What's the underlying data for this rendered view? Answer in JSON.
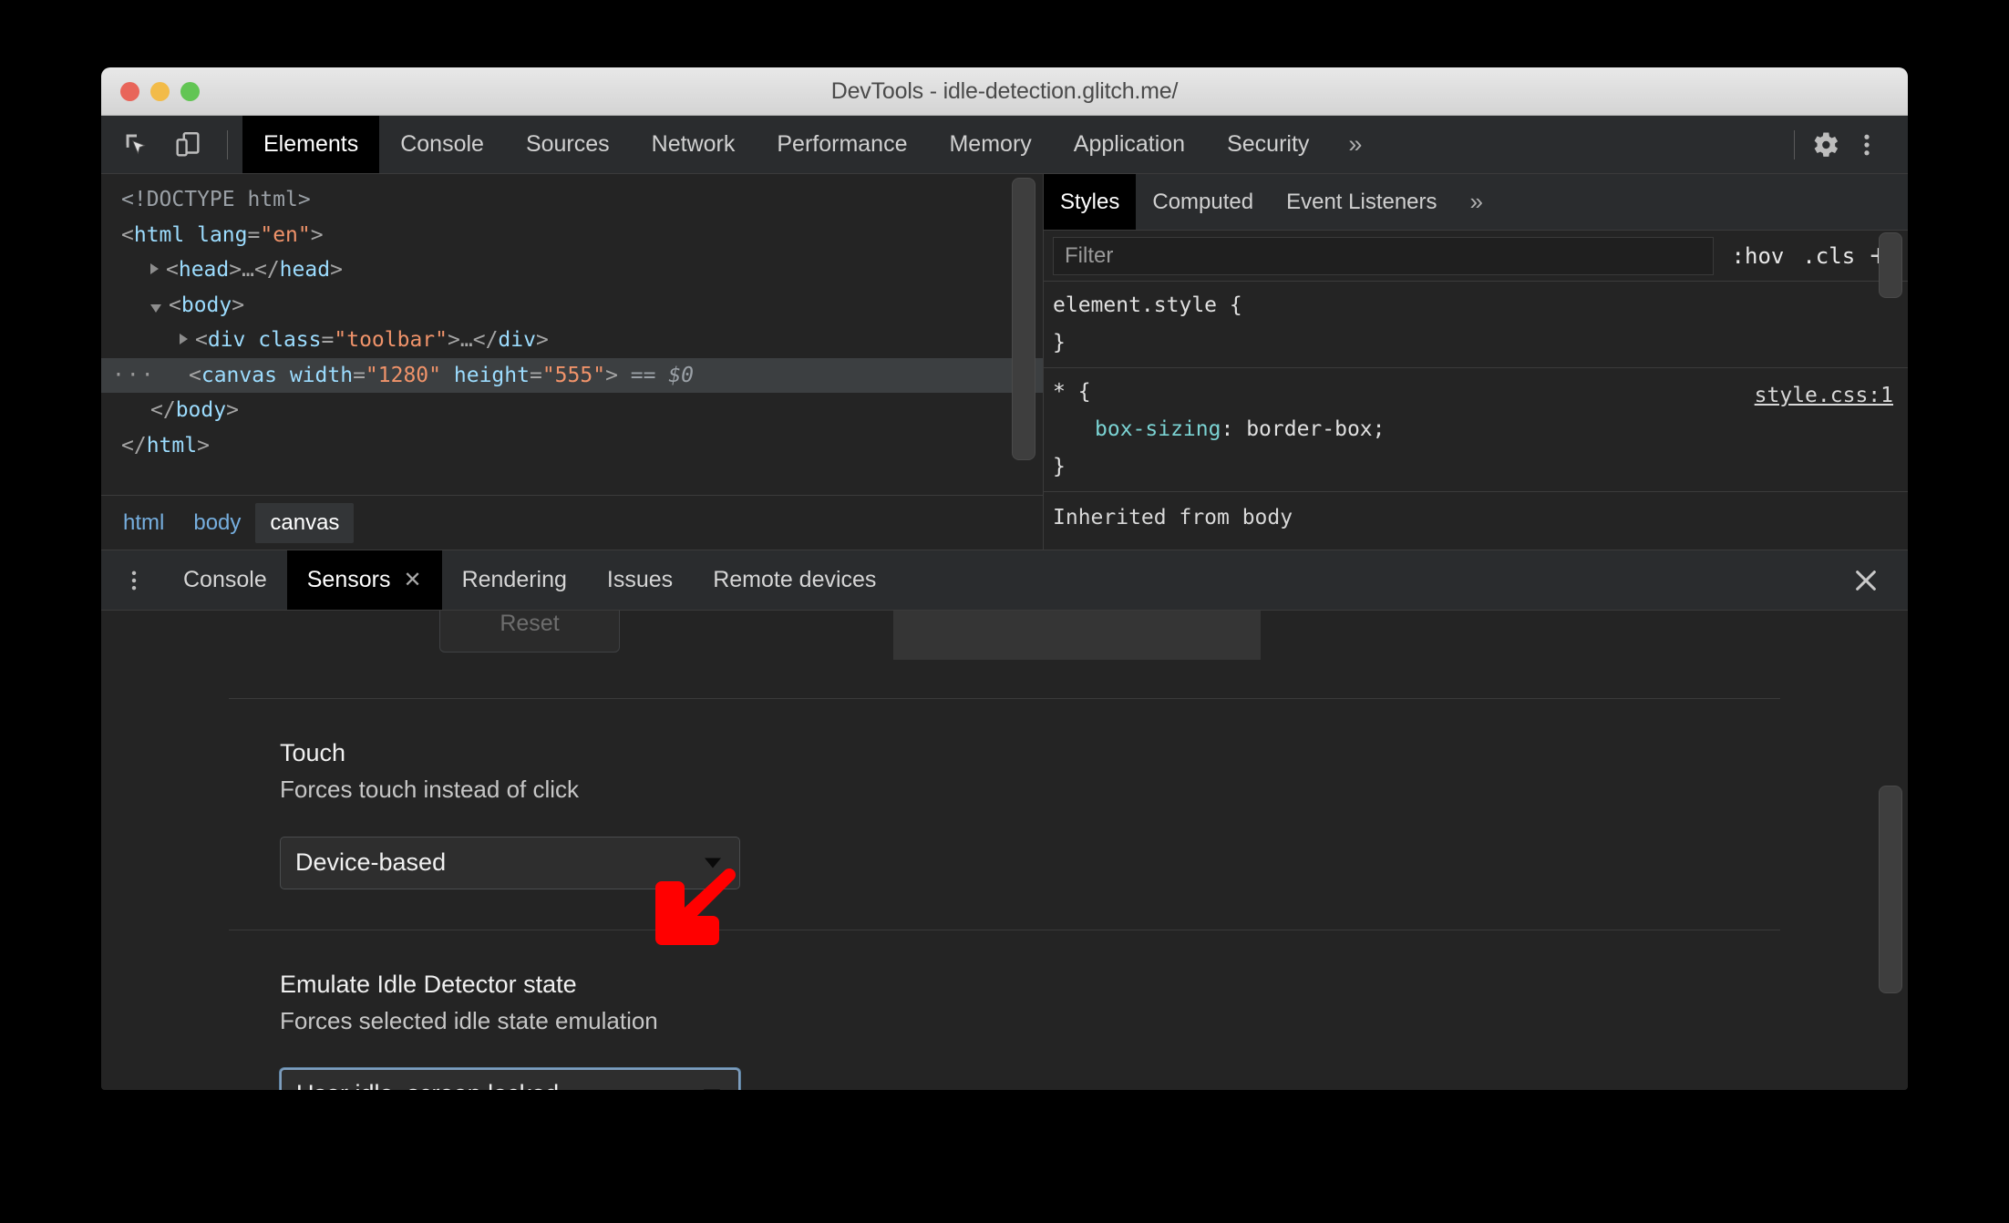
{
  "window": {
    "title": "DevTools - idle-detection.glitch.me/"
  },
  "toolbar": {
    "inspect_icon": "inspect-element-icon",
    "device_icon": "device-toolbar-icon",
    "tabs": [
      {
        "label": "Elements",
        "active": true
      },
      {
        "label": "Console",
        "active": false
      },
      {
        "label": "Sources",
        "active": false
      },
      {
        "label": "Network",
        "active": false
      },
      {
        "label": "Performance",
        "active": false
      },
      {
        "label": "Memory",
        "active": false
      },
      {
        "label": "Application",
        "active": false
      },
      {
        "label": "Security",
        "active": false
      }
    ],
    "more_tabs": "»",
    "settings_icon": "gear-icon",
    "menu_icon": "kebab-menu-icon"
  },
  "dom_tree": {
    "lines": [
      {
        "text": "<!DOCTYPE html>"
      },
      {
        "text": "<html lang=\"en\">"
      },
      {
        "text": "<head>…</head>"
      },
      {
        "text": "<body>"
      },
      {
        "text": "<div class=\"toolbar\">…</div>"
      },
      {
        "text": "<canvas width=\"1280\" height=\"555\"> == $0"
      },
      {
        "text": "</body>"
      },
      {
        "text": "</html>"
      }
    ],
    "doctype": "<!DOCTYPE html>",
    "html_open_tag": "html",
    "html_attr_name": "lang",
    "html_attr_value": "\"en\"",
    "head_tag": "head",
    "body_tag": "body",
    "div_tag": "div",
    "div_attr_name": "class",
    "div_attr_value": "\"toolbar\"",
    "canvas_tag": "canvas",
    "canvas_attr1_name": "width",
    "canvas_attr1_value": "\"1280\"",
    "canvas_attr2_name": "height",
    "canvas_attr2_value": "\"555\"",
    "selected_marker": "== $0",
    "ellipsis": "…",
    "row_menu": "···"
  },
  "breadcrumb": {
    "items": [
      {
        "label": "html",
        "active": false
      },
      {
        "label": "body",
        "active": false
      },
      {
        "label": "canvas",
        "active": true
      }
    ]
  },
  "styles_panel": {
    "tabs": [
      {
        "label": "Styles",
        "active": true
      },
      {
        "label": "Computed",
        "active": false
      },
      {
        "label": "Event Listeners",
        "active": false
      }
    ],
    "more_tabs": "»",
    "filter_placeholder": "Filter",
    "hov_label": ":hov",
    "cls_label": ".cls",
    "new_rule_label": "+",
    "rules": [
      {
        "selector": "element.style {",
        "close": "}",
        "source": "",
        "declarations": []
      },
      {
        "selector": "* {",
        "close": "}",
        "source": "style.css:1",
        "declarations": [
          {
            "name": "box-sizing",
            "value": "border-box;"
          }
        ]
      }
    ],
    "inherited_label": "Inherited from body"
  },
  "drawer": {
    "menu_icon": "kebab-menu-icon",
    "tabs": [
      {
        "label": "Console",
        "active": false,
        "closable": false
      },
      {
        "label": "Sensors",
        "active": true,
        "closable": true
      },
      {
        "label": "Rendering",
        "active": false,
        "closable": false
      },
      {
        "label": "Issues",
        "active": false,
        "closable": false
      },
      {
        "label": "Remote devices",
        "active": false,
        "closable": false
      }
    ],
    "close_label": "✕",
    "close_icon": "close-icon"
  },
  "sensors": {
    "reset_button": "Reset",
    "touch": {
      "title": "Touch",
      "subtitle": "Forces touch instead of click",
      "select_value": "Device-based"
    },
    "idle": {
      "title": "Emulate Idle Detector state",
      "subtitle": "Forces selected idle state emulation",
      "select_value": "User idle, screen locked"
    }
  },
  "annotation": {
    "arrow_icon": "red-arrow-down-left-icon",
    "color": "#ff0000"
  },
  "colors": {
    "background": "#242424",
    "toolbar": "#2a2c2e",
    "active_tab": "#000000",
    "accent_link": "#76aede",
    "tag_blue": "#9cdcfe",
    "attr_orange": "#f0936a",
    "prop_teal": "#7bd3d3",
    "focus_ring": "#7f9fbf"
  }
}
